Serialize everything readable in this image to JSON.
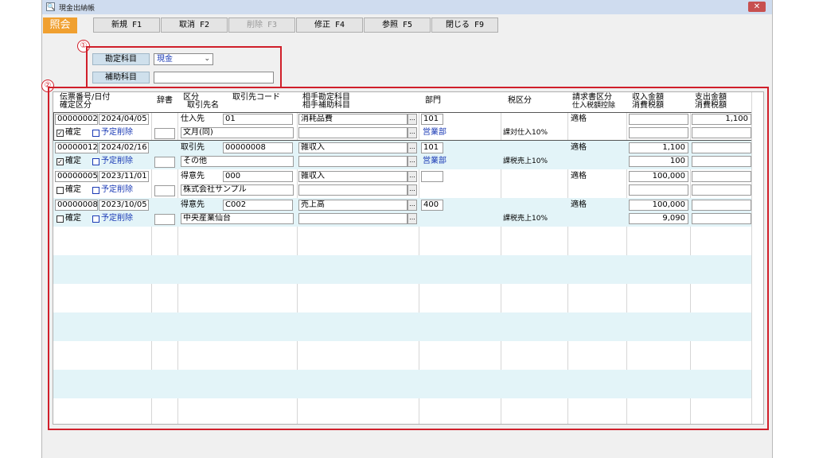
{
  "window": {
    "title": "現金出納帳",
    "close_glyph": "✕",
    "icon_glyph": "🔍"
  },
  "toolbar": {
    "mode": "照会",
    "buttons": [
      {
        "label": "新規 F1",
        "enabled": true
      },
      {
        "label": "取消 F2",
        "enabled": true
      },
      {
        "label": "削除 F3",
        "enabled": false
      },
      {
        "label": "修正 F4",
        "enabled": true
      },
      {
        "label": "参照 F5",
        "enabled": true
      },
      {
        "label": "閉じる F9",
        "enabled": true
      }
    ]
  },
  "markers": {
    "one": "①",
    "two": "②"
  },
  "filters": {
    "account_label": "勘定科目",
    "account_value": "現金",
    "sub_account_label": "補助科目",
    "sub_account_value": ""
  },
  "grid": {
    "headers": {
      "slip": "伝票番号/日付",
      "confirm": "確定区分",
      "dict": "辞書",
      "kubun": "区分",
      "partner_name": "取引先名",
      "partner_code": "取引先コード",
      "counter_account": "相手勘定科目",
      "counter_sub": "相手補助科目",
      "dept": "部門",
      "tax": "税区分",
      "invoice": "請求書区分",
      "purchase_deduct": "仕入税額控除",
      "income": "収入金額",
      "income_tax": "消費税額",
      "expense": "支出金額",
      "expense_tax": "消費税額"
    },
    "rows": [
      {
        "slip_no": "00000002",
        "date": "2024/04/05",
        "confirmed": true,
        "confirm_label": "確定",
        "check_glyph": "✓",
        "pending_label": "予定削除",
        "kubun": "仕入先",
        "partner_code": "01",
        "partner_name": "文月(同)",
        "counter_account": "消耗品費",
        "counter_sub": "",
        "dept_code": "101",
        "dept_name": "営業部",
        "tax": "課対仕入10%",
        "invoice": "適格",
        "income": "",
        "income_tax": "",
        "expense": "1,100",
        "expense_tax": ""
      },
      {
        "slip_no": "00000012",
        "date": "2024/02/16",
        "confirmed": true,
        "confirm_label": "確定",
        "check_glyph": "✓",
        "pending_label": "予定削除",
        "kubun": "取引先",
        "partner_code": "00000008",
        "partner_name": "その他",
        "counter_account": "雑収入",
        "counter_sub": "",
        "dept_code": "101",
        "dept_name": "営業部",
        "tax": "課税売上10%",
        "invoice": "適格",
        "income": "1,100",
        "income_tax": "100",
        "expense": "",
        "expense_tax": ""
      },
      {
        "slip_no": "00000005",
        "date": "2023/11/01",
        "confirmed": false,
        "confirm_label": "確定",
        "check_glyph": "",
        "pending_label": "予定削除",
        "kubun": "得意先",
        "partner_code": "000",
        "partner_name": "株式会社サンプル",
        "counter_account": "雑収入",
        "counter_sub": "",
        "dept_code": "",
        "dept_name": "",
        "tax": "",
        "invoice": "適格",
        "income": "100,000",
        "income_tax": "",
        "expense": "",
        "expense_tax": ""
      },
      {
        "slip_no": "00000008",
        "date": "2023/10/05",
        "confirmed": false,
        "confirm_label": "確定",
        "check_glyph": "",
        "pending_label": "予定削除",
        "kubun": "得意先",
        "partner_code": "C002",
        "partner_name": "中央産業仙台",
        "counter_account": "売上高",
        "counter_sub": "",
        "dept_code": "400",
        "dept_name": "",
        "tax": "課税売上10%",
        "invoice": "適格",
        "income": "100,000",
        "income_tax": "9,090",
        "expense": "",
        "expense_tax": ""
      }
    ],
    "ellipsis": "..."
  },
  "colors": {
    "accent_mode": "#f0a030",
    "annotation_red": "#d01f2a",
    "row_alt": "#e3f4f8",
    "link_blue": "#1a3ab5"
  }
}
